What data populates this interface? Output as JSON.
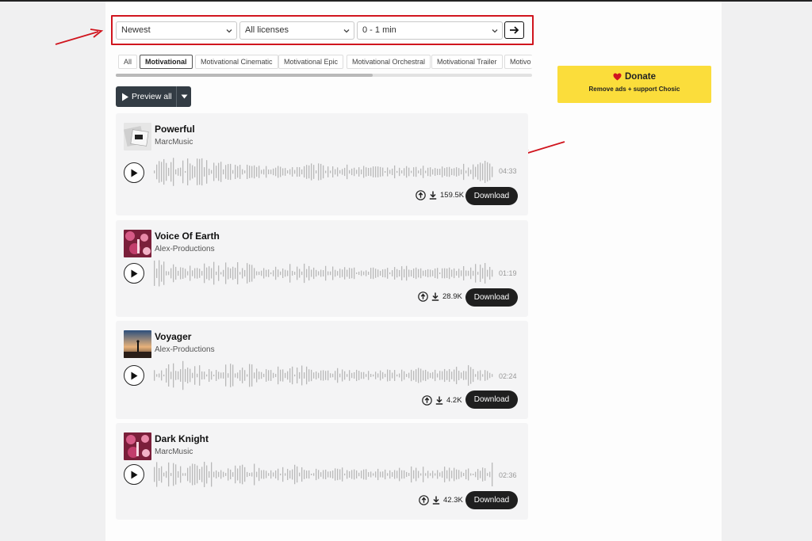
{
  "filters": {
    "sort": "Newest",
    "license": "All licenses",
    "duration": "0 - 1 min"
  },
  "chips": [
    {
      "label": "All",
      "active": false
    },
    {
      "label": "Motivational",
      "active": true
    },
    {
      "label": "Motivational Cinematic",
      "active": false
    },
    {
      "label": "Motivational Epic",
      "active": false
    },
    {
      "label": "Motivational Orchestral",
      "active": false
    },
    {
      "label": "Motivational Trailer",
      "active": false
    },
    {
      "label": "Motivo",
      "active": false
    }
  ],
  "preview": {
    "label": "Preview all"
  },
  "donate": {
    "title": "Donate",
    "subtitle": "Remove ads + support Chosic",
    "color": "#fbdd3b"
  },
  "tracks": [
    {
      "title": "Powerful",
      "artist": "MarcMusic",
      "duration": "04:33",
      "downloads": "159.5K",
      "download_label": "Download"
    },
    {
      "title": "Voice Of Earth",
      "artist": "Alex-Productions",
      "duration": "01:19",
      "downloads": "28.9K",
      "download_label": "Download"
    },
    {
      "title": "Voyager",
      "artist": "Alex-Productions",
      "duration": "02:24",
      "downloads": "4.2K",
      "download_label": "Download"
    },
    {
      "title": "Dark Knight",
      "artist": "MarcMusic",
      "duration": "02:36",
      "downloads": "42.3K",
      "download_label": "Download"
    }
  ],
  "colors": {
    "highlight": "#d0151e",
    "accent_dark": "#1f1f1f",
    "heart": "#d0151e"
  }
}
